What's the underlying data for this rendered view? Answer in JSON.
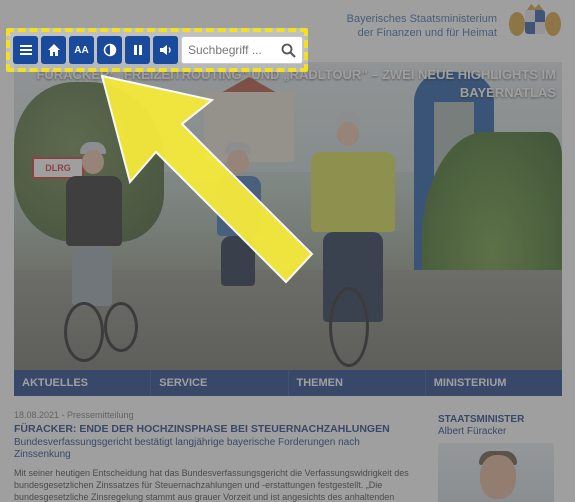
{
  "header": {
    "ministry_line1": "Bayerisches Staatsministerium",
    "ministry_line2": "der Finanzen und für Heimat"
  },
  "toolbar": {
    "buttons": [
      {
        "icon": "menu-icon"
      },
      {
        "icon": "home-icon"
      },
      {
        "icon": "font-size-icon",
        "label": "AA"
      },
      {
        "icon": "contrast-icon"
      },
      {
        "icon": "pause-icon"
      },
      {
        "icon": "speaker-icon"
      }
    ],
    "search": {
      "placeholder": "Suchbegriff ..."
    }
  },
  "hero": {
    "title": "Füracker: „Freizeitrouting\" und „Radltour\" – Zwei neue Highlights im BayernAtlas",
    "sign_text": "DLRG"
  },
  "nav": {
    "items": [
      "AKTUELLES",
      "SERVICE",
      "THEMEN",
      "MINISTERIUM"
    ]
  },
  "article": {
    "meta": "18.08.2021 - Pressemitteilung",
    "headline": "FÜRACKER: ENDE DER HOCHZINSPHASE BEI STEUERNACHZAHLUNGEN",
    "subhead": "Bundesverfassungsgericht bestätigt langjährige bayerische Forderungen nach Zinssenkung",
    "body": "Mit seiner heutigen Entscheidung hat das Bundesverfassungsgericht die Verfassungswidrigkeit des bundesgesetzlichen Zinssatzes für Steuernachzahlungen und -erstattungen festgestellt. „Die bundesgesetzliche Zinsregelung stammt aus grauer Vorzeit und ist angesichts des anhaltenden"
  },
  "sidebar": {
    "title": "STAATSMINISTER",
    "name": "Albert Füracker"
  },
  "colors": {
    "brand_blue": "#1a3f86",
    "toolbar_blue": "#1a4a9b",
    "highlight_yellow": "#f3e021"
  }
}
